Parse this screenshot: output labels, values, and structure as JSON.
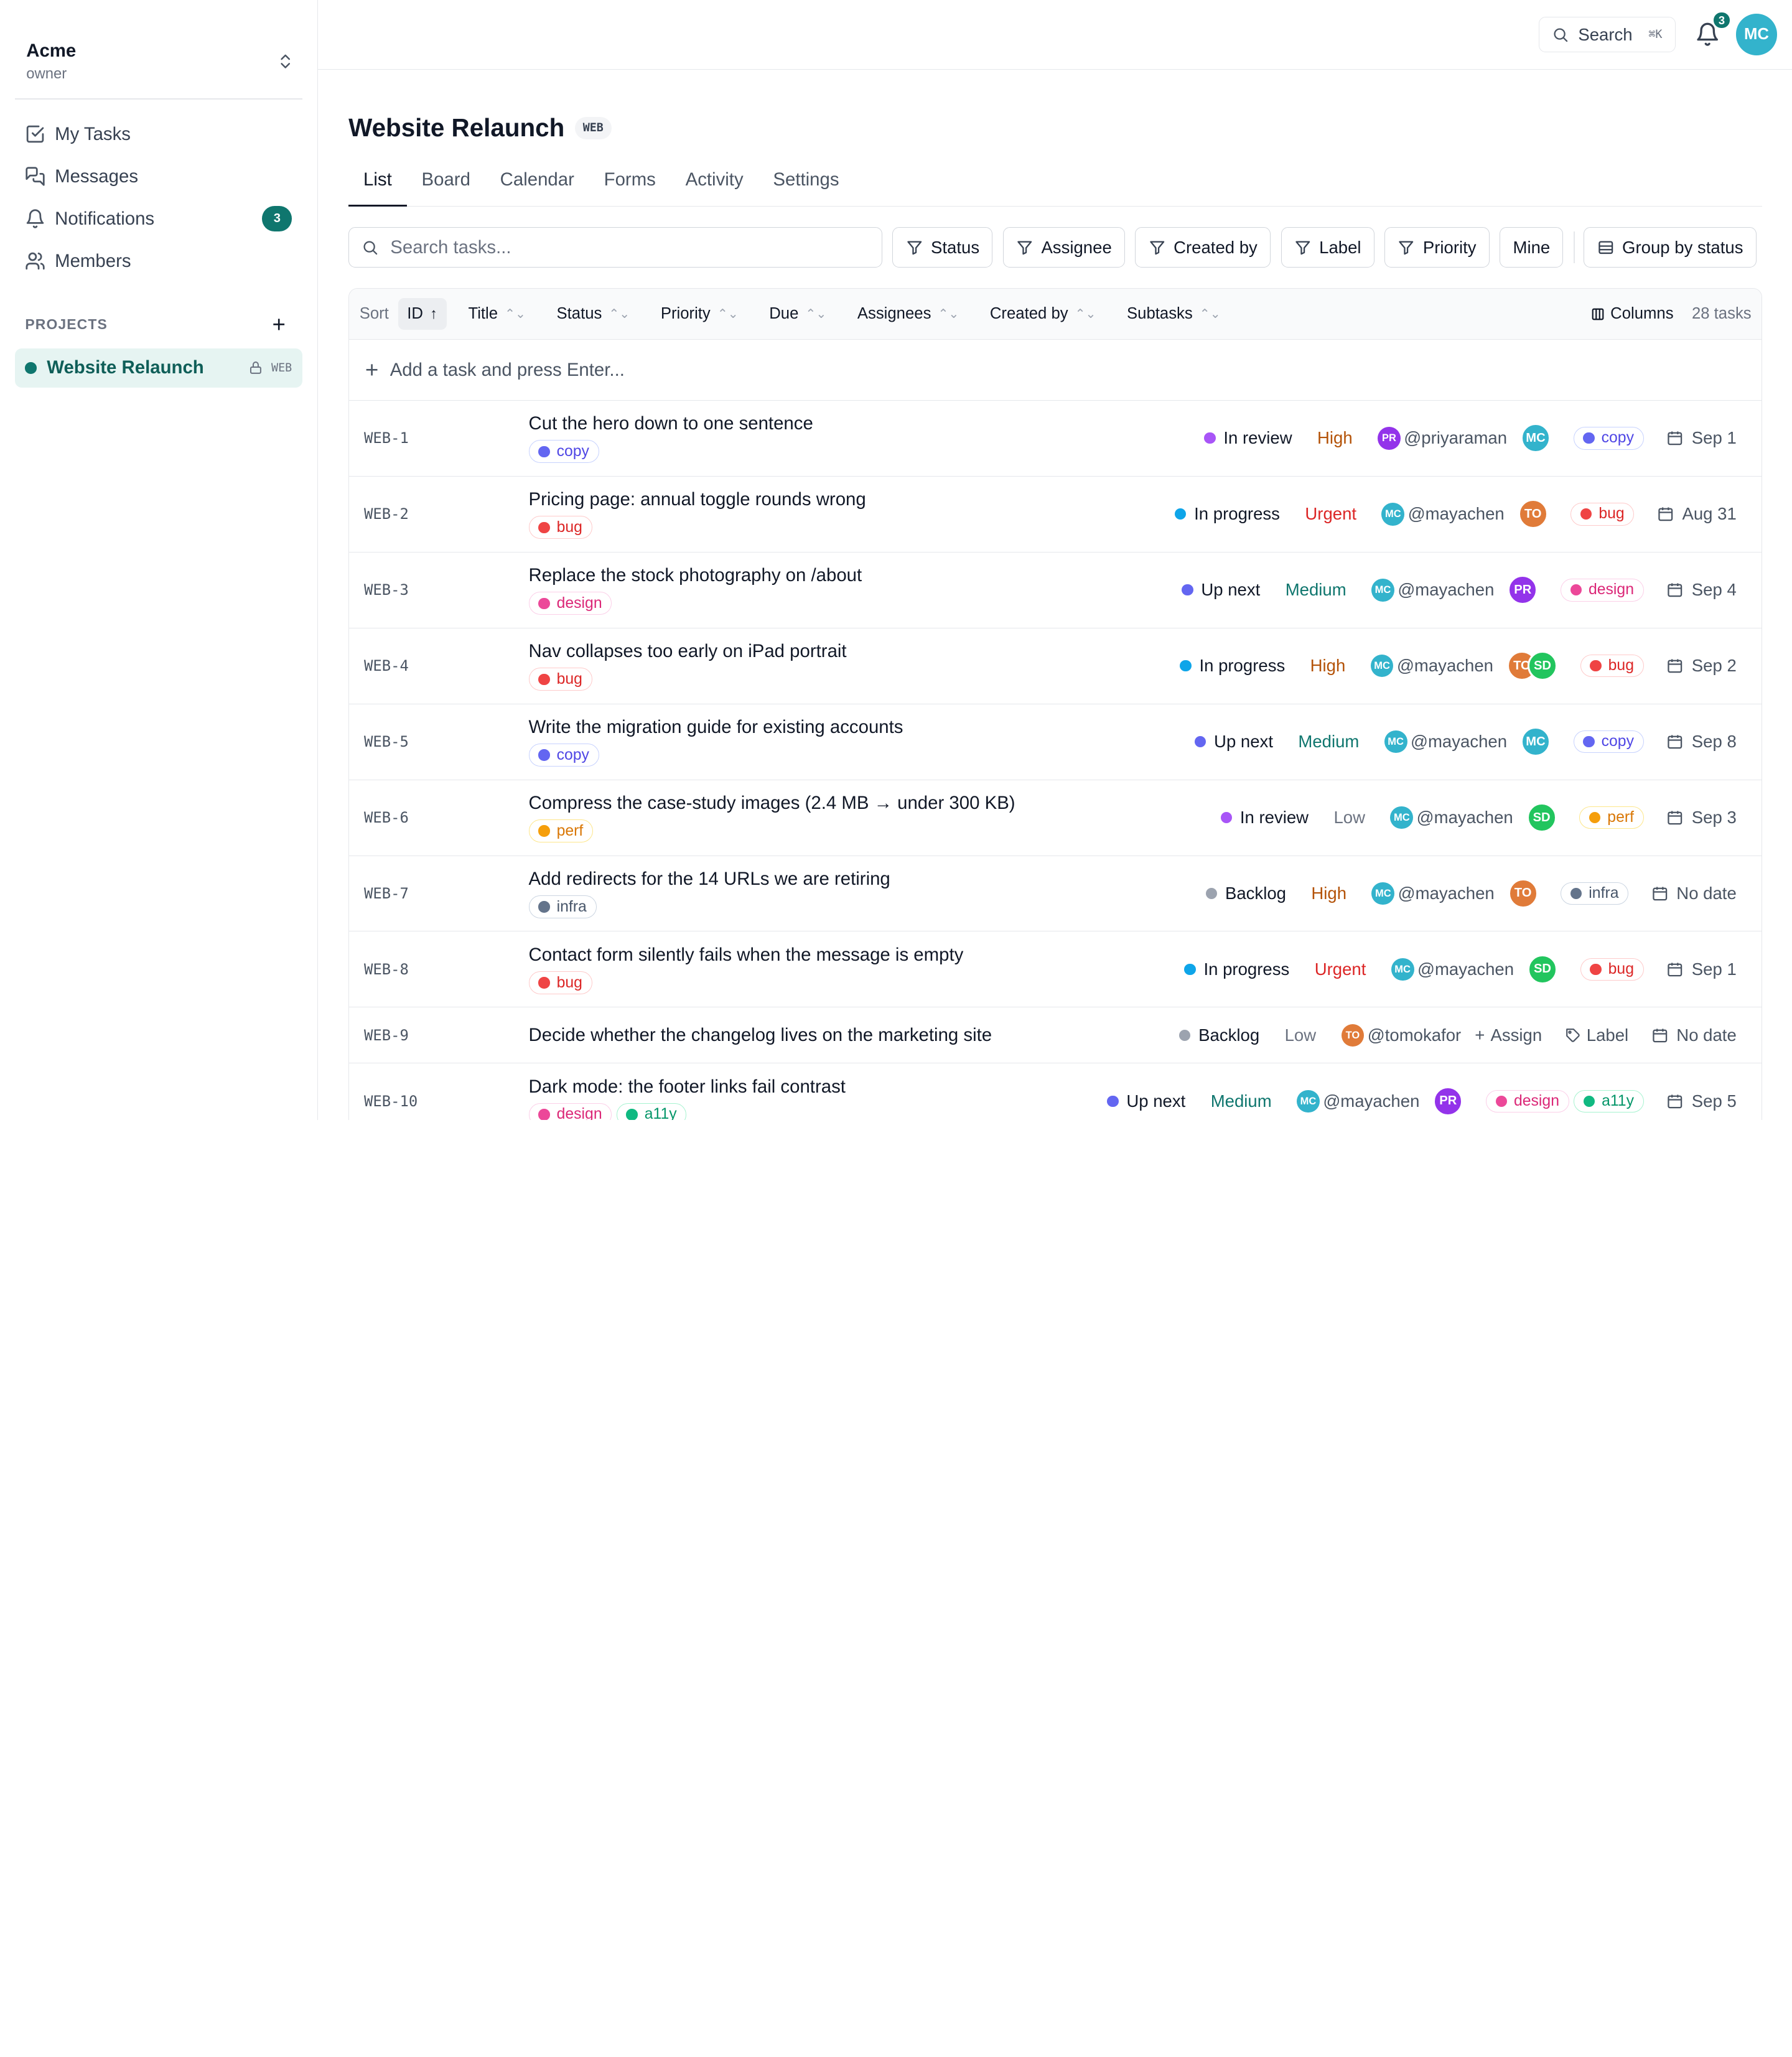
{
  "org": {
    "name": "Acme",
    "role": "owner"
  },
  "nav": [
    {
      "label": "My Tasks",
      "icon": "check-square-icon"
    },
    {
      "label": "Messages",
      "icon": "chat-icon"
    },
    {
      "label": "Notifications",
      "icon": "bell-icon",
      "badge": "3"
    },
    {
      "label": "Members",
      "icon": "users-icon"
    }
  ],
  "projects": {
    "heading": "PROJECTS",
    "add_label": "+",
    "items": [
      {
        "name": "Website Relaunch",
        "key": "WEB",
        "color": "#0f766e"
      }
    ]
  },
  "topbar": {
    "search_label": "Search",
    "search_kbd": "⌘K",
    "notif_count": "3",
    "user_initials": "MC",
    "user_color": "#33b3cc"
  },
  "page": {
    "title": "Website Relaunch",
    "key": "WEB"
  },
  "tabs": [
    "List",
    "Board",
    "Calendar",
    "Forms",
    "Activity",
    "Settings"
  ],
  "active_tab": "List",
  "filters": {
    "search_placeholder": "Search tasks...",
    "buttons": [
      "Status",
      "Assignee",
      "Created by",
      "Label",
      "Priority"
    ],
    "mine": "Mine",
    "group": "Group by status"
  },
  "table": {
    "sort_label": "Sort",
    "columns": [
      "ID",
      "Title",
      "Status",
      "Priority",
      "Due",
      "Assignees",
      "Created by",
      "Subtasks"
    ],
    "columns_button": "Columns",
    "count": "28 tasks",
    "add_placeholder": "Add a task and press Enter..."
  },
  "colors": {
    "status": {
      "In review": "#a855f7",
      "In progress": "#0ea5e9",
      "Up next": "#6366f1",
      "Backlog": "#9ca3af"
    },
    "priority": {
      "High": "#b45309",
      "Urgent": "#dc2626",
      "Medium": "#0f766e",
      "Low": "#6b7280"
    },
    "labels": {
      "copy": {
        "dot": "#6366f1",
        "border": "#c7d2fe",
        "text": "#4f46e5"
      },
      "bug": {
        "dot": "#ef4444",
        "border": "#fecaca",
        "text": "#dc2626"
      },
      "design": {
        "dot": "#ec4899",
        "border": "#fbcfe8",
        "text": "#db2777"
      },
      "perf": {
        "dot": "#f59e0b",
        "border": "#fde68a",
        "text": "#d97706"
      },
      "infra": {
        "dot": "#64748b",
        "border": "#cbd5e1",
        "text": "#475569"
      },
      "a11y": {
        "dot": "#10b981",
        "border": "#a7f3d0",
        "text": "#059669"
      }
    },
    "avatars": {
      "MC": "#33b3cc",
      "PR": "#9333ea",
      "TO": "#e07b39",
      "SD": "#22c55e"
    }
  },
  "tasks": [
    {
      "id": "WEB-1",
      "title": "Cut the hero down to one sentence",
      "labels": [
        "copy"
      ],
      "status": "In review",
      "priority": "High",
      "creator": "PR",
      "creator_handle": "@priyaraman",
      "assignees": [
        "MC"
      ],
      "meta_label": "copy",
      "due": "Sep 1"
    },
    {
      "id": "WEB-2",
      "title": "Pricing page: annual toggle rounds wrong",
      "labels": [
        "bug"
      ],
      "status": "In progress",
      "priority": "Urgent",
      "creator": "MC",
      "creator_handle": "@mayachen",
      "assignees": [
        "TO"
      ],
      "meta_label": "bug",
      "due": "Aug 31"
    },
    {
      "id": "WEB-3",
      "title": "Replace the stock photography on /about",
      "labels": [
        "design"
      ],
      "status": "Up next",
      "priority": "Medium",
      "creator": "MC",
      "creator_handle": "@mayachen",
      "assignees": [
        "PR"
      ],
      "meta_label": "design",
      "due": "Sep 4"
    },
    {
      "id": "WEB-4",
      "title": "Nav collapses too early on iPad portrait",
      "labels": [
        "bug"
      ],
      "status": "In progress",
      "priority": "High",
      "creator": "MC",
      "creator_handle": "@mayachen",
      "assignees": [
        "TO",
        "SD"
      ],
      "meta_label": "bug",
      "due": "Sep 2"
    },
    {
      "id": "WEB-5",
      "title": "Write the migration guide for existing accounts",
      "labels": [
        "copy"
      ],
      "status": "Up next",
      "priority": "Medium",
      "creator": "MC",
      "creator_handle": "@mayachen",
      "assignees": [
        "MC"
      ],
      "meta_label": "copy",
      "due": "Sep 8"
    },
    {
      "id": "WEB-6",
      "title": "Compress the case-study images (2.4 MB → under 300 KB)",
      "labels": [
        "perf"
      ],
      "status": "In review",
      "priority": "Low",
      "creator": "MC",
      "creator_handle": "@mayachen",
      "assignees": [
        "SD"
      ],
      "meta_label": "perf",
      "due": "Sep 3"
    },
    {
      "id": "WEB-7",
      "title": "Add redirects for the 14 URLs we are retiring",
      "labels": [
        "infra"
      ],
      "status": "Backlog",
      "priority": "High",
      "creator": "MC",
      "creator_handle": "@mayachen",
      "assignees": [
        "TO"
      ],
      "meta_label": "infra",
      "due": "No date"
    },
    {
      "id": "WEB-8",
      "title": "Contact form silently fails when the message is empty",
      "labels": [
        "bug"
      ],
      "status": "In progress",
      "priority": "Urgent",
      "creator": "MC",
      "creator_handle": "@mayachen",
      "assignees": [
        "SD"
      ],
      "meta_label": "bug",
      "due": "Sep 1"
    },
    {
      "id": "WEB-9",
      "title": "Decide whether the changelog lives on the marketing site",
      "labels": [],
      "status": "Backlog",
      "priority": "Low",
      "creator": "TO",
      "creator_handle": "@tomokafor",
      "assignees": [],
      "assign_placeholder": "Assign",
      "label_placeholder": "Label",
      "meta_label": "",
      "due": "No date"
    },
    {
      "id": "WEB-10",
      "title": "Dark mode: the footer links fail contrast",
      "labels": [
        "design",
        "a11y"
      ],
      "status": "Up next",
      "priority": "Medium",
      "creator": "MC",
      "creator_handle": "@mayachen",
      "assignees": [
        "PR"
      ],
      "meta_labels": [
        "design",
        "a11y"
      ],
      "due": "Sep 5"
    }
  ]
}
